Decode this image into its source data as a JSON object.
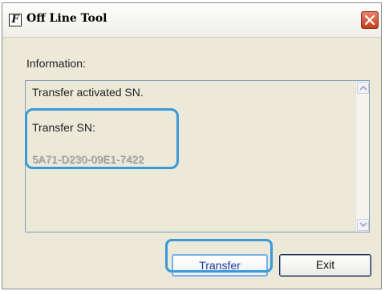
{
  "window": {
    "title": "Off Line Tool",
    "app_icon_glyph": "F",
    "close_icon": "close-icon"
  },
  "info": {
    "label": "Information:",
    "line1": "Transfer activated SN.",
    "line2": "Transfer SN:",
    "serial": "5A71-D230-09E1-7422"
  },
  "buttons": {
    "transfer": "Transfer",
    "exit": "Exit"
  },
  "colors": {
    "highlight": "#3a9ad9",
    "window_bg": "#ece9d8",
    "close_red": "#c1401f"
  }
}
